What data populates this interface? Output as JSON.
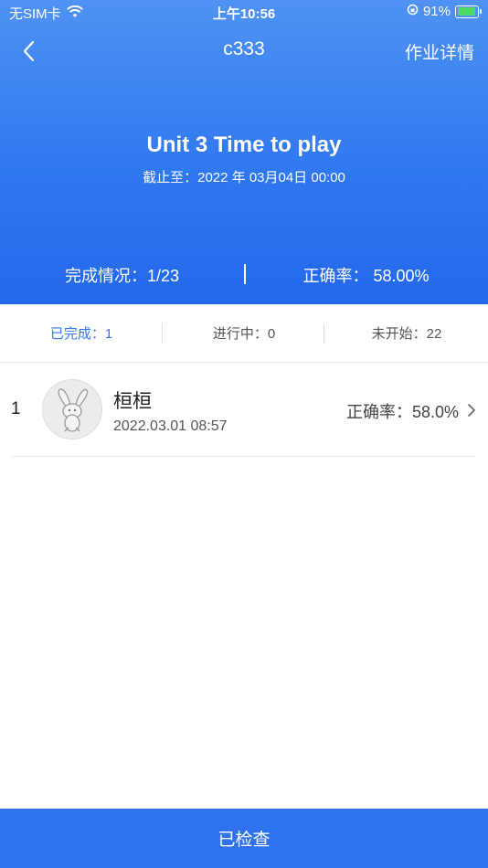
{
  "status_bar": {
    "carrier": "无SIM卡",
    "time": "上午10:56",
    "battery_percent": "91%",
    "battery_level": 0.91
  },
  "nav": {
    "title": "c333",
    "action_label": "作业详情"
  },
  "homework": {
    "title": "Unit 3 Time to play",
    "deadline": "截止至：2022 年 03月04日 00:00"
  },
  "summary": {
    "completion": "完成情况：1/23",
    "accuracy": "正确率：  58.00%"
  },
  "filters": [
    {
      "label": "已完成：1",
      "active": true
    },
    {
      "label": "进行中：0",
      "active": false
    },
    {
      "label": "未开始：22",
      "active": false
    }
  ],
  "students": [
    {
      "index": "1",
      "name": "桓桓",
      "time": "2022.03.01 08:57",
      "accuracy": "正确率：58.0%"
    }
  ],
  "bottom_button": "已检查",
  "colors": {
    "accent": "#2f78f0",
    "header_gradient_top": "#4f92f3",
    "header_gradient_bottom": "#2468ec",
    "button": "#2f72ee"
  }
}
